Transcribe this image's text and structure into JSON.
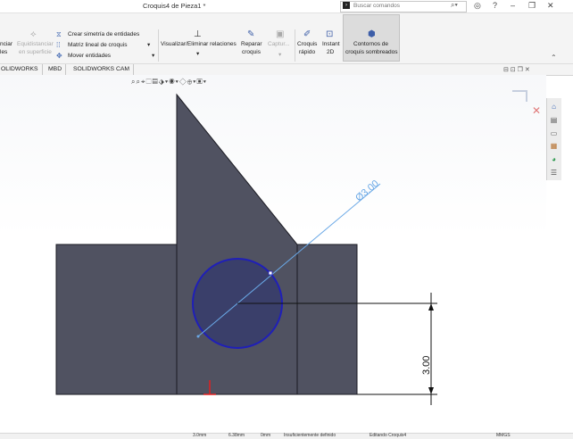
{
  "window": {
    "title": "Croquis4 de Pieza1 *"
  },
  "search": {
    "placeholder": "Buscar comandos"
  },
  "ribbon": {
    "cut1": "nciar",
    "cut2": "les",
    "equi1": "Equidistanciar",
    "equi2": "en superficie",
    "mirror": "Crear simetría de entidades",
    "matrix": "Matriz lineal de croquis",
    "move": "Mover entidades",
    "relations": "Visualizar/Eliminar relaciones",
    "repair1": "Reparar",
    "repair2": "croquis",
    "capture": "Captur...",
    "quick1": "Croquis",
    "quick2": "rápido",
    "instant1": "Instant",
    "instant2": "2D",
    "contours1": "Contornos de",
    "contours2": "croquis sombreados"
  },
  "tabs": [
    "OLIDWORKS",
    "MBD",
    "SOLIDWORKS CAM"
  ],
  "sketch": {
    "diameter_label": "Ø3.00",
    "height_label": "3.00"
  },
  "status": {
    "fields": [
      "3.0mm",
      "6.38mm",
      "0mm",
      "Insuficientemente definido",
      "Editando Croquis4",
      "MMGS"
    ]
  },
  "colors": {
    "part_fill": "#505261",
    "circle_stroke": "#1f1fb8",
    "dimension_line": "#6aa8e6",
    "origin": "#e02020"
  }
}
